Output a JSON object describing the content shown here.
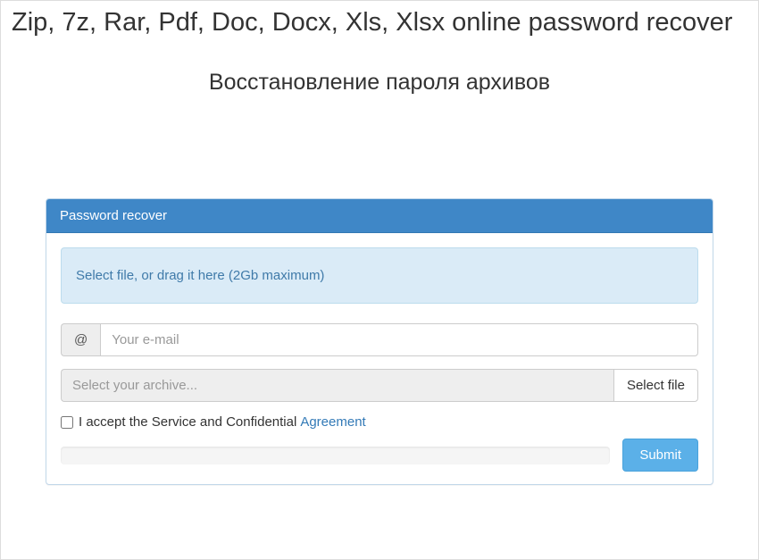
{
  "header": {
    "title_main": "Zip, 7z, Rar, Pdf, Doc, Docx, Xls, Xlsx online password recover",
    "title_sub": "Восстановление пароля архивов"
  },
  "panel": {
    "heading": "Password recover",
    "dropzone_text": "Select file, or drag it here (2Gb maximum)",
    "email": {
      "addon": "@",
      "placeholder": "Your e-mail",
      "value": ""
    },
    "file": {
      "placeholder": "Select your archive...",
      "button_label": "Select file"
    },
    "agreement": {
      "text": "I accept the Service and Confidential",
      "link_text": "Agreement"
    },
    "submit_label": "Submit"
  }
}
